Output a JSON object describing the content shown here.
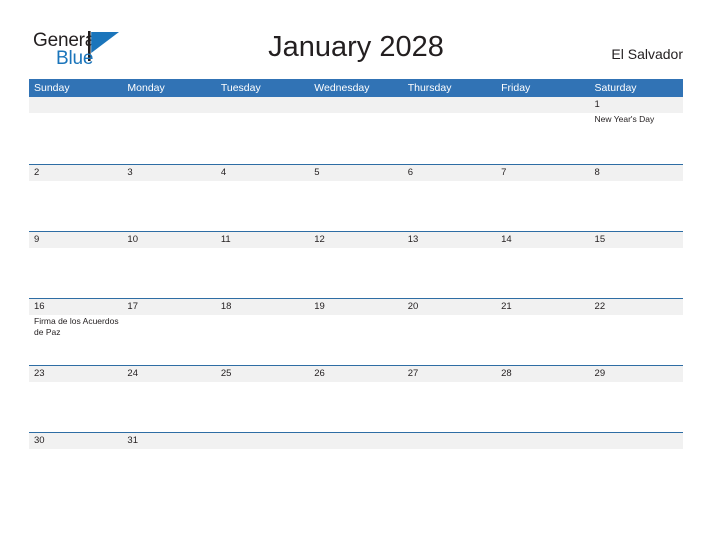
{
  "brand": {
    "word_general": "General",
    "word_blue": "Blue",
    "flag_icon": "flag-pennant-icon",
    "accent_color": "#1b75bb",
    "text_color": "#231f20"
  },
  "header": {
    "title": "January 2028",
    "country": "El Salvador"
  },
  "calendar": {
    "header_bg": "#3173b5",
    "row_band_bg": "#f1f1f1",
    "row_border": "#2e6da4",
    "weekdays": [
      "Sunday",
      "Monday",
      "Tuesday",
      "Wednesday",
      "Thursday",
      "Friday",
      "Saturday"
    ],
    "weeks": [
      {
        "days": [
          {
            "num": "",
            "events": []
          },
          {
            "num": "",
            "events": []
          },
          {
            "num": "",
            "events": []
          },
          {
            "num": "",
            "events": []
          },
          {
            "num": "",
            "events": []
          },
          {
            "num": "",
            "events": []
          },
          {
            "num": "1",
            "events": [
              "New Year's Day"
            ]
          }
        ]
      },
      {
        "days": [
          {
            "num": "2",
            "events": []
          },
          {
            "num": "3",
            "events": []
          },
          {
            "num": "4",
            "events": []
          },
          {
            "num": "5",
            "events": []
          },
          {
            "num": "6",
            "events": []
          },
          {
            "num": "7",
            "events": []
          },
          {
            "num": "8",
            "events": []
          }
        ]
      },
      {
        "days": [
          {
            "num": "9",
            "events": []
          },
          {
            "num": "10",
            "events": []
          },
          {
            "num": "11",
            "events": []
          },
          {
            "num": "12",
            "events": []
          },
          {
            "num": "13",
            "events": []
          },
          {
            "num": "14",
            "events": []
          },
          {
            "num": "15",
            "events": []
          }
        ]
      },
      {
        "days": [
          {
            "num": "16",
            "events": [
              "Firma de los Acuerdos de Paz"
            ]
          },
          {
            "num": "17",
            "events": []
          },
          {
            "num": "18",
            "events": []
          },
          {
            "num": "19",
            "events": []
          },
          {
            "num": "20",
            "events": []
          },
          {
            "num": "21",
            "events": []
          },
          {
            "num": "22",
            "events": []
          }
        ]
      },
      {
        "days": [
          {
            "num": "23",
            "events": []
          },
          {
            "num": "24",
            "events": []
          },
          {
            "num": "25",
            "events": []
          },
          {
            "num": "26",
            "events": []
          },
          {
            "num": "27",
            "events": []
          },
          {
            "num": "28",
            "events": []
          },
          {
            "num": "29",
            "events": []
          }
        ]
      },
      {
        "days": [
          {
            "num": "30",
            "events": []
          },
          {
            "num": "31",
            "events": []
          },
          {
            "num": "",
            "events": []
          },
          {
            "num": "",
            "events": []
          },
          {
            "num": "",
            "events": []
          },
          {
            "num": "",
            "events": []
          },
          {
            "num": "",
            "events": []
          }
        ]
      }
    ]
  }
}
